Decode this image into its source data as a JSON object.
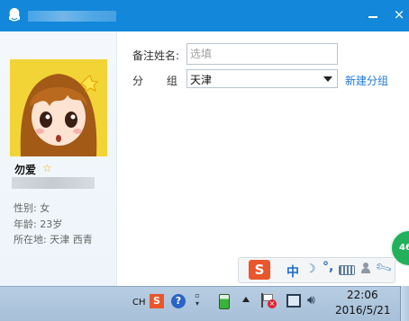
{
  "window": {
    "minimize_icon": "minimize-icon",
    "close_label": "×"
  },
  "profile": {
    "nickname": "勿爱",
    "gender": "性别: 女",
    "age": "年龄: 23岁",
    "location": "所在地: 天津  西青"
  },
  "form": {
    "remark_label": "备注姓名:",
    "remark_placeholder": "选填",
    "remark_value": "",
    "group_label": "分 组:",
    "group_value": "天津",
    "new_group_link": "新建分组"
  },
  "ime": {
    "sogou_label": "S",
    "mode_label": "中",
    "punct_label": "°,"
  },
  "badge": {
    "count": "46"
  },
  "taskbar": {
    "lang_label": "CH",
    "tray_sogou": "S",
    "tray_help": "?",
    "clock_time": "22:06",
    "clock_date": "2016/5/21"
  },
  "colors": {
    "titlebar": "#1387d9",
    "link": "#1d7ad6",
    "badge": "#23b05b",
    "sogou": "#e9562b"
  }
}
